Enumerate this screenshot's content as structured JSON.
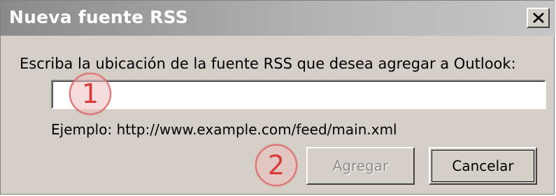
{
  "dialog": {
    "title": "Nueva fuente RSS",
    "prompt": "Escriba la ubicación de la fuente RSS que desea agregar a Outlook:",
    "url_input": {
      "value": "",
      "placeholder": ""
    },
    "example": "Ejemplo: http://www.example.com/feed/main.xml",
    "buttons": {
      "add": "Agregar",
      "cancel": "Cancelar"
    },
    "close_icon": "close-icon"
  },
  "markers": [
    "1",
    "2"
  ],
  "colors": {
    "dialog_background": "#d4d0c8",
    "titlebar_start": "#8a8a8a",
    "titlebar_end": "#c6c6c6",
    "marker_red": "#d83a3a",
    "disabled_text": "#8c8c8c"
  }
}
